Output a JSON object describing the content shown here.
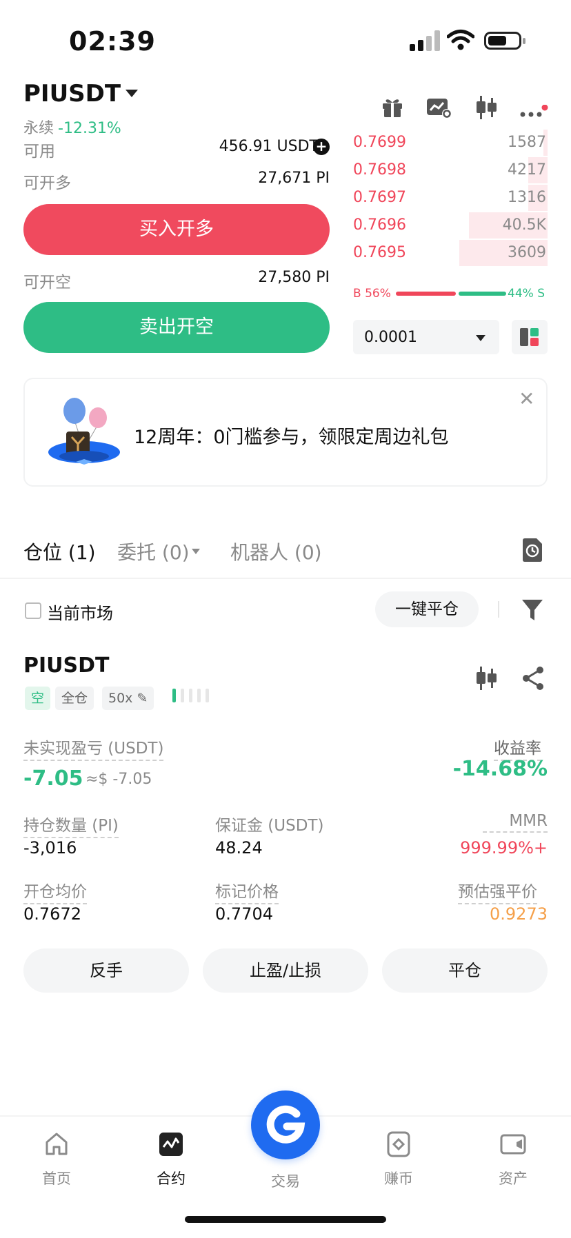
{
  "status_bar": {
    "time": "02:39"
  },
  "header": {
    "pair": "PIUSDT",
    "contract_type": "永续",
    "change": "-12.31%",
    "icons": [
      "gift-icon",
      "chart-edit-icon",
      "candlestick-icon",
      "more-icon"
    ]
  },
  "trade_panel": {
    "available_label": "可用",
    "available_value": "456.91 USDT",
    "open_long_label": "可开多",
    "open_long_value": "27,671 PI",
    "buy_button": "买入开多",
    "open_short_label": "可开空",
    "open_short_value": "27,580 PI",
    "sell_button": "卖出开空"
  },
  "order_book": {
    "asks": [
      {
        "price": "0.7699",
        "qty": "1587",
        "depth": 0.02
      },
      {
        "price": "0.7698",
        "qty": "4217",
        "depth": 0.1
      },
      {
        "price": "0.7697",
        "qty": "1316",
        "depth": 0.1
      },
      {
        "price": "0.7696",
        "qty": "40.5K",
        "depth": 0.4
      },
      {
        "price": "0.7695",
        "qty": "3609",
        "depth": 0.45
      }
    ],
    "buy_ratio": "B 56%",
    "sell_ratio": "44% S",
    "buy_ratio_value": 0.56,
    "precision": "0.0001"
  },
  "banner": {
    "text": "12周年：0门槛参与，领限定周边礼包"
  },
  "tabs": {
    "positions": "仓位 (1)",
    "orders": "委托 (0)",
    "bots": "机器人 (0)"
  },
  "filters": {
    "current_market": "当前市场",
    "close_all": "一键平仓"
  },
  "position": {
    "symbol": "PIUSDT",
    "side": "空",
    "margin_mode": "全仓",
    "leverage": "50x",
    "unrealized_pnl_label": "未实现盈亏 (USDT)",
    "unrealized_pnl": "-7.05",
    "unrealized_pnl_usd": "≈$ -7.05",
    "roe_label": "收益率",
    "roe": "-14.68%",
    "size_label": "持仓数量 (PI)",
    "size": "-3,016",
    "margin_label": "保证金 (USDT)",
    "margin": "48.24",
    "mmr_label": "MMR",
    "mmr": "999.99%+",
    "entry_label": "开仓均价",
    "entry": "0.7672",
    "mark_label": "标记价格",
    "mark": "0.7704",
    "liq_label": "预估强平价",
    "liq": "0.9273",
    "buttons": {
      "reverse": "反手",
      "tpsl": "止盈/止损",
      "close": "平仓"
    }
  },
  "bottom_nav": {
    "home": "首页",
    "futures": "合约",
    "trade": "交易",
    "earn": "赚币",
    "assets": "资产"
  },
  "colors": {
    "red": "#f0465a",
    "green": "#2ebd85",
    "orange": "#f5a04a",
    "blue": "#1f6bf0"
  }
}
